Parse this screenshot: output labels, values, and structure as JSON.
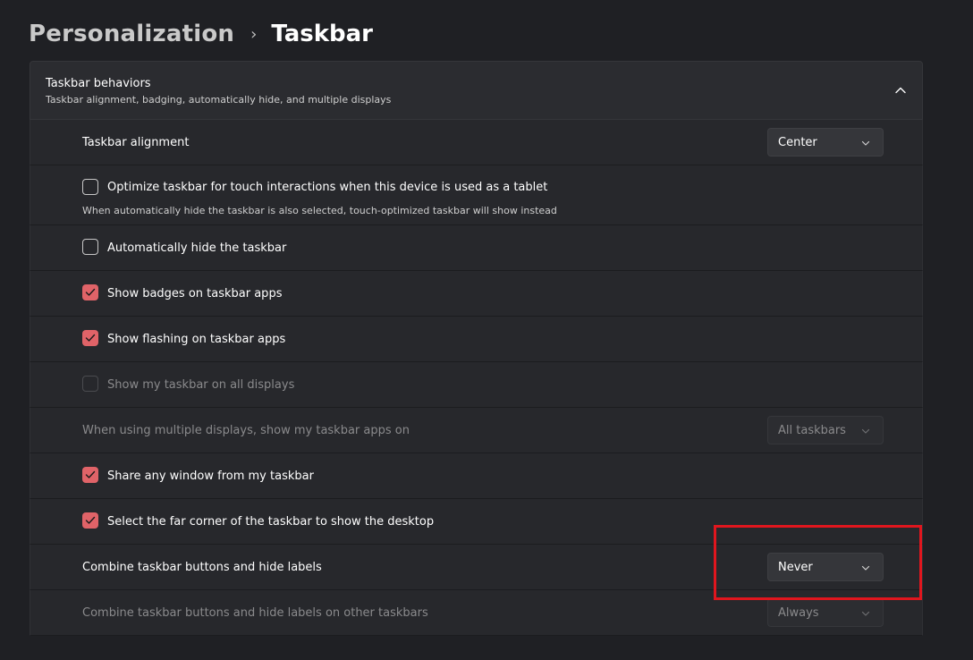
{
  "breadcrumb": {
    "parent": "Personalization",
    "separator": "›",
    "current": "Taskbar"
  },
  "section": {
    "title": "Taskbar behaviors",
    "subtitle": "Taskbar alignment, badging, automatically hide, and multiple displays",
    "expanded": true
  },
  "rows": {
    "alignment": {
      "label": "Taskbar alignment",
      "value": "Center"
    },
    "touch": {
      "label": "Optimize taskbar for touch interactions when this device is used as a tablet",
      "description": "When automatically hide the taskbar is also selected, touch-optimized taskbar will show instead",
      "checked": false
    },
    "autohide": {
      "label": "Automatically hide the taskbar",
      "checked": false
    },
    "badges": {
      "label": "Show badges on taskbar apps",
      "checked": true
    },
    "flashing": {
      "label": "Show flashing on taskbar apps",
      "checked": true
    },
    "all_displays": {
      "label": "Show my taskbar on all displays",
      "checked": false,
      "disabled": true
    },
    "multi_display_apps": {
      "label": "When using multiple displays, show my taskbar apps on",
      "value": "All taskbars",
      "disabled": true
    },
    "share_window": {
      "label": "Share any window from my taskbar",
      "checked": true
    },
    "far_corner": {
      "label": "Select the far corner of the taskbar to show the desktop",
      "checked": true
    },
    "combine": {
      "label": "Combine taskbar buttons and hide labels",
      "value": "Never"
    },
    "combine_other": {
      "label": "Combine taskbar buttons and hide labels on other taskbars",
      "value": "Always",
      "disabled": true
    }
  },
  "colors": {
    "accent": "#e06368",
    "highlight": "#e0161e",
    "background": "#1f2024"
  }
}
